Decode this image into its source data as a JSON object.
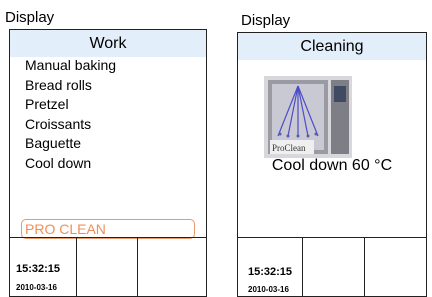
{
  "left": {
    "title": "Display",
    "header": "Work",
    "items": [
      "Manual baking",
      "Bread rolls",
      "Pretzel",
      "Croissants",
      "Baguette",
      "Cool down"
    ],
    "selected_item": "PRO CLEAN",
    "time": "15:32:15",
    "date": "2010-03-16"
  },
  "right": {
    "title": "Display",
    "header": "Cleaning",
    "image_caption": "ProClean",
    "status": "Cool down 60 °C",
    "time": "15:32:15",
    "date": "2010-03-16"
  },
  "colors": {
    "header_bg": "#e3eefb",
    "selection": "#ee8f5a"
  }
}
